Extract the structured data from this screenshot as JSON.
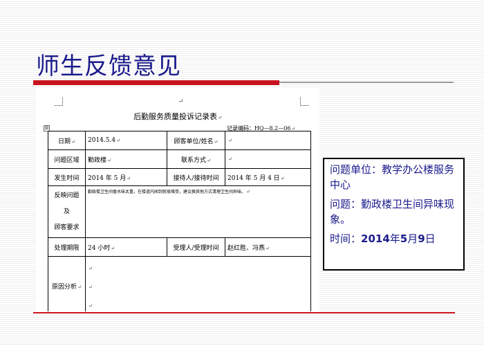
{
  "slide": {
    "title": "师生反馈意见"
  },
  "document": {
    "title": "后勤服务质量投诉记录表",
    "record_no": "记录编码：HQ—8.2—06",
    "paragraph_mark": "↵",
    "table_handle_glyph": "⊞",
    "rows": {
      "date_label": "日期",
      "date_value": "2014.5.4",
      "customer_unit_label": "顾客单位/姓名",
      "customer_unit_value": "",
      "problem_area_label": "问题区域",
      "problem_area_value": "勤政楼",
      "contact_label": "联系方式",
      "contact_value": "",
      "occur_time_label": "发生时间",
      "occur_time_value": "2014 年 5 月",
      "receiver_time_label": "接待人/接待时间",
      "receiver_time_value": "2014 年 5 月 4 日",
      "report_label_1": "反映问题",
      "report_label_2": "及",
      "report_label_3": "顾客要求",
      "report_value": "勤政楼卫生间香水味太重，在楼道内闻到就很难受，建议换其他方式清理卫生间异味。",
      "deadline_label": "处理期限",
      "deadline_value": "24 小时",
      "handler_time_label": "受理人/受理时间",
      "handler_time_value": "赵红胜、冯燕",
      "cause_label": "原因分析"
    }
  },
  "info_box": {
    "unit_line": "问题单位：教学办公楼服务中心",
    "issue_line": "问题：勤政楼卫生间异味现象。",
    "time_prefix": "时间：",
    "time_year": "2014",
    "time_year_unit": "年",
    "time_month": "5",
    "time_month_unit": "月",
    "time_day": "9",
    "time_day_unit": "日"
  },
  "colors": {
    "title_blue": "#1a1a8c",
    "accent_red": "#c8141e"
  }
}
